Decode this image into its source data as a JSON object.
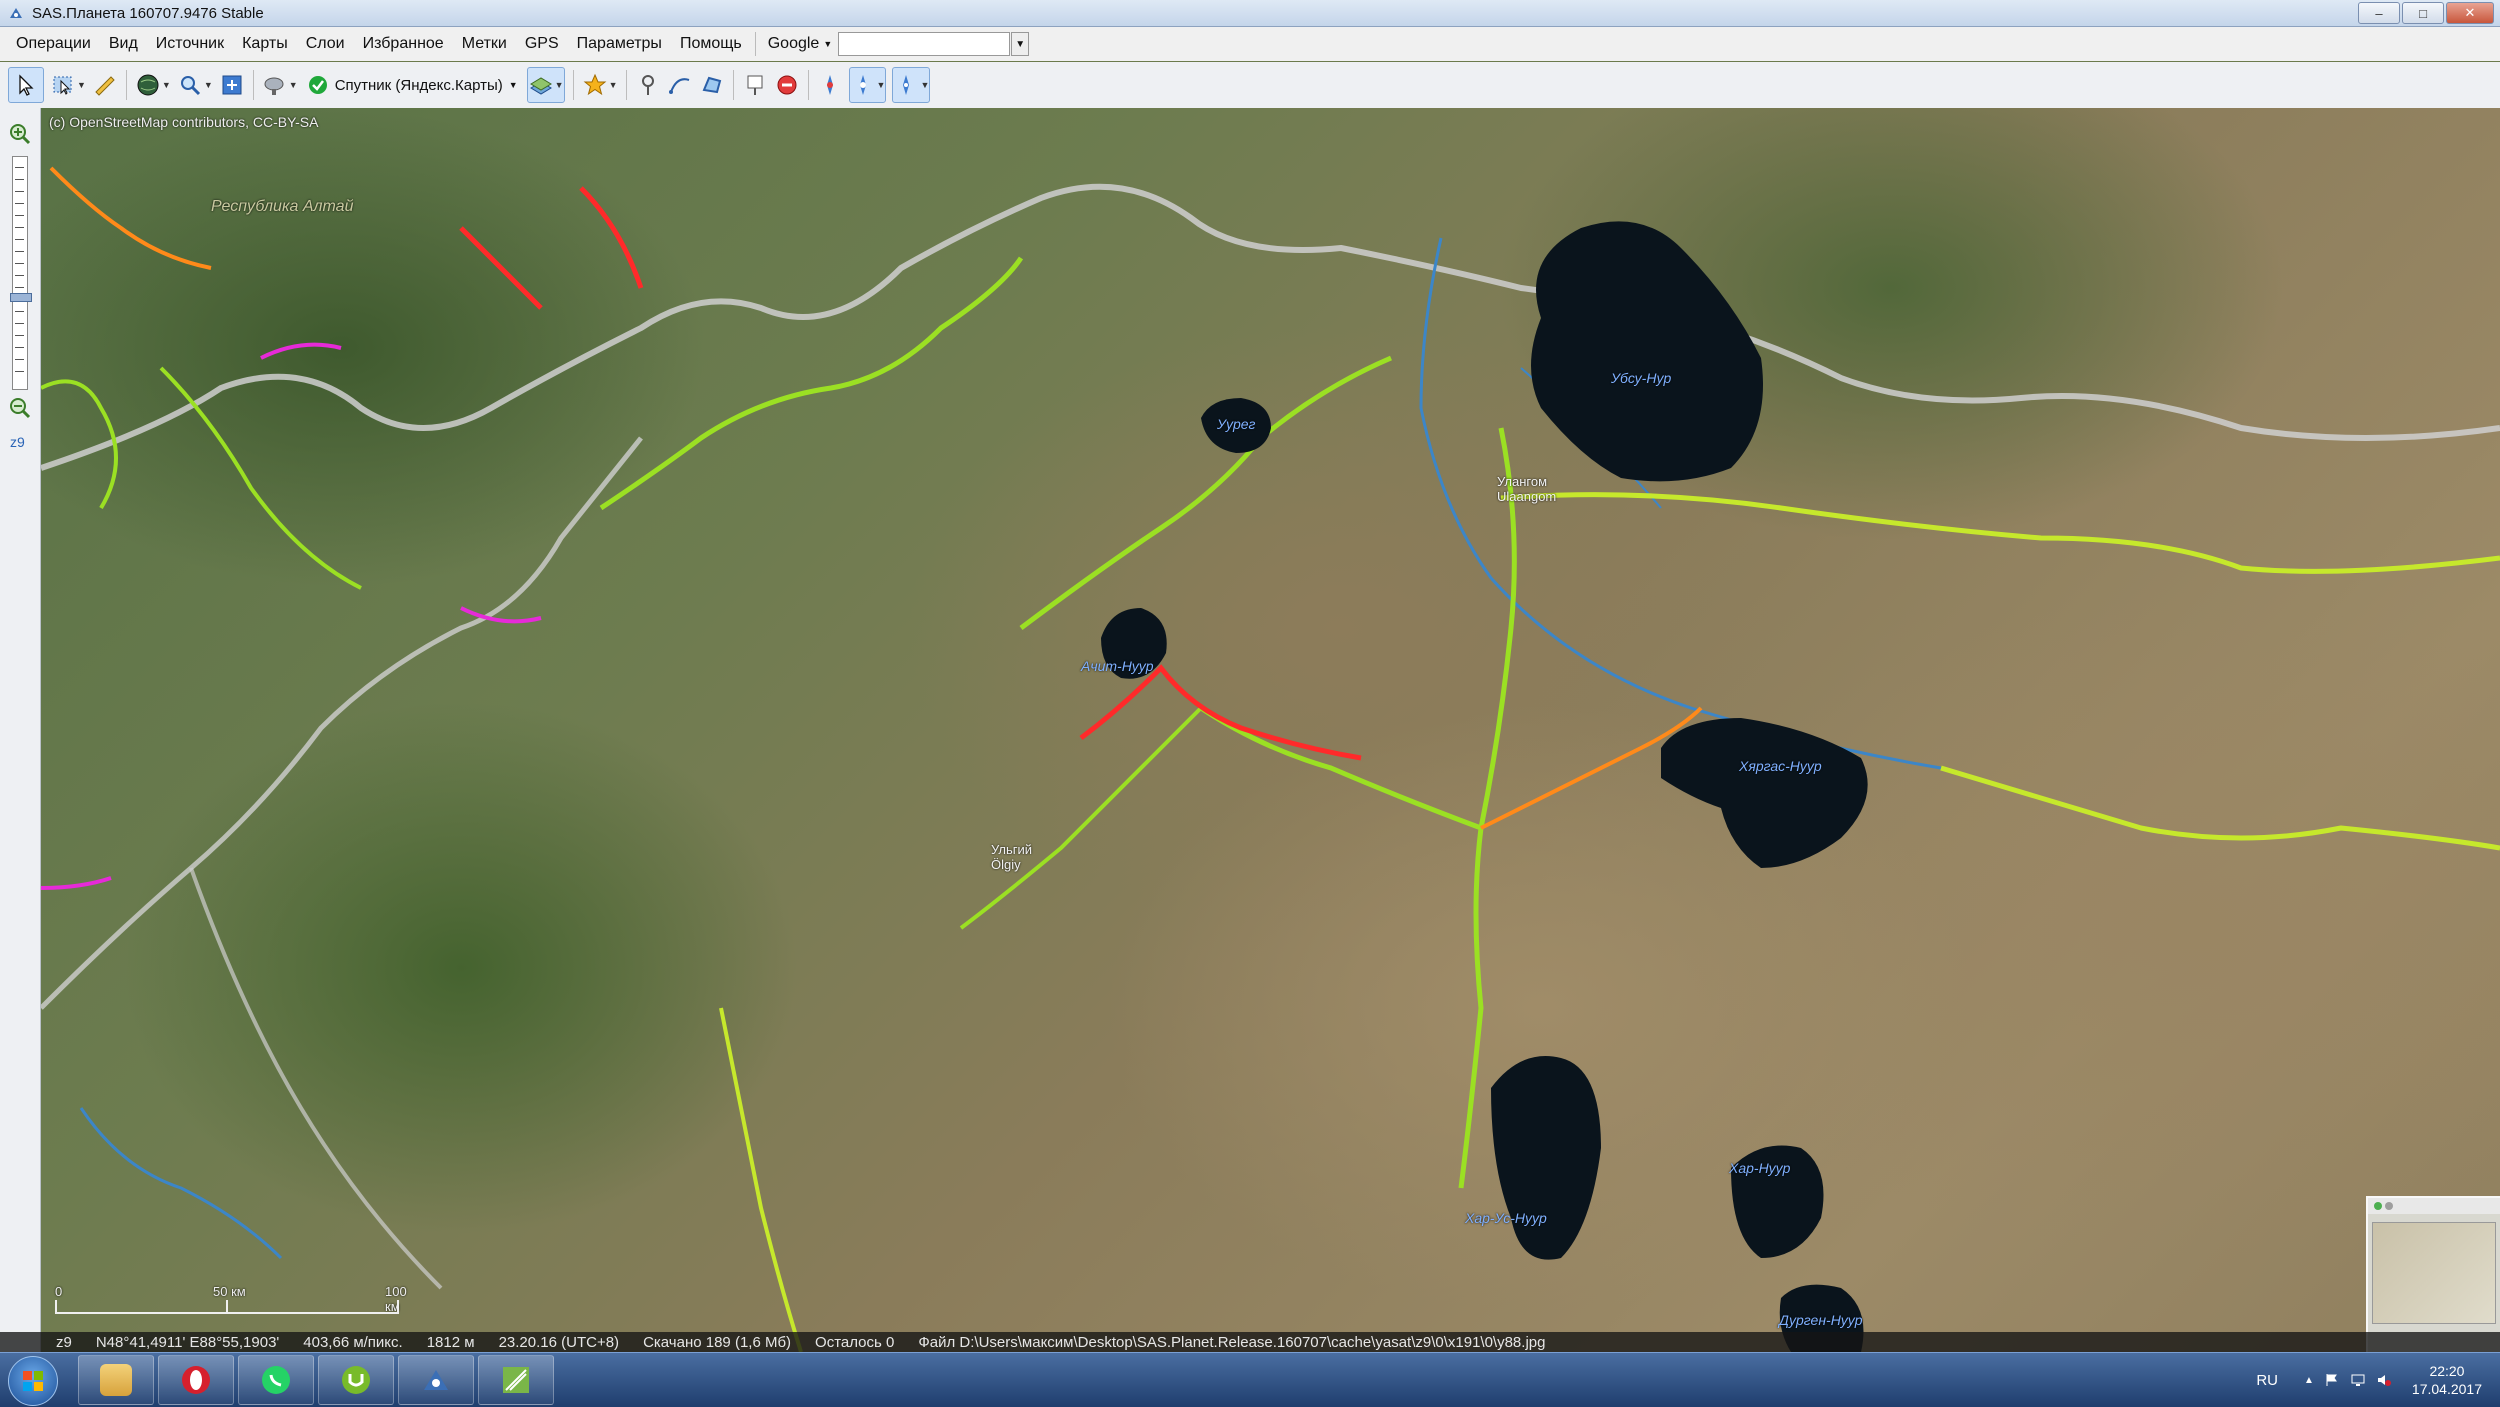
{
  "window": {
    "title": "SAS.Планета 160707.9476 Stable",
    "minimize": "–",
    "maximize": "□",
    "close": "✕"
  },
  "menu": {
    "items": [
      "Операции",
      "Вид",
      "Источник",
      "Карты",
      "Слои",
      "Избранное",
      "Метки",
      "GPS",
      "Параметры",
      "Помощь"
    ],
    "search_provider": "Google",
    "search_value": ""
  },
  "toolbar": {
    "map_source_label": "Спутник (Яндекс.Карты)"
  },
  "leftpanel": {
    "zoom_level": "z9"
  },
  "map": {
    "attribution": "(c) OpenStreetMap contributors, CC-BY-SA",
    "labels": {
      "respublika_altai": "Республика Алтай",
      "ubsu_nur": "Убсу-Нур",
      "ureg": "Уурег",
      "ulangom_ru": "Улангом",
      "ulangom_en": "Ulaangom",
      "achit_nuur": "Ачит-Нуур",
      "ulgiy_ru": "Ульгий",
      "ulgiy_en": "Ölgiy",
      "khyargas_nuur": "Хяргас-Нуур",
      "khar_us_nuur": "Хар-Ус-Нуур",
      "khar_nuur": "Хар-Нуур",
      "durgen_nuur": "Дурген-Нуур"
    },
    "scale": {
      "zero": "0",
      "mid": "50 км",
      "end": "100 км"
    }
  },
  "status": {
    "zoom": "z9",
    "coords": "N48°41,4911' E88°55,1903'",
    "resolution": "403,66 м/пикс.",
    "elevation": "1812 м",
    "time": "23.20.16 (UTC+8)",
    "downloaded": "Скачано 189 (1,6 Мб)",
    "remaining": "Осталось 0",
    "file": "Файл D:\\Users\\максим\\Desktop\\SAS.Planet.Release.160707\\cache\\yasat\\z9\\0\\x191\\0\\y88.jpg"
  },
  "taskbar": {
    "items": [
      "opera-icon",
      "whatsapp-icon",
      "utorrent-icon",
      "sasplanet-icon",
      "map-app-icon"
    ],
    "lang": "RU",
    "time": "22:20",
    "date": "17.04.2017"
  },
  "colors": {
    "road_green": "#9be023",
    "road_yellow": "#d8e63a",
    "road_red": "#ff2a2a",
    "road_orange": "#ff8a1a",
    "road_magenta": "#e62ad8",
    "border_gray": "#c8c8c8",
    "river_blue": "#3c86c8",
    "lake_fill": "#0a141c"
  }
}
